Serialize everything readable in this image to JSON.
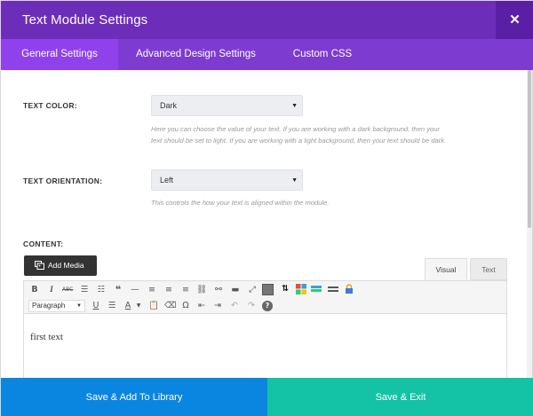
{
  "header": {
    "title": "Text Module Settings",
    "close_icon": "close-icon"
  },
  "tabs": [
    {
      "label": "General Settings",
      "active": true
    },
    {
      "label": "Advanced Design Settings",
      "active": false
    },
    {
      "label": "Custom CSS",
      "active": false
    }
  ],
  "fields": {
    "text_color": {
      "label": "TEXT COLOR:",
      "value": "Dark",
      "description_line1": "Here you can choose the value of your text. If you are working with a dark background, then your",
      "description_line2": "text should be set to light. If you are working with a light background, then your text should be dark."
    },
    "text_orientation": {
      "label": "TEXT ORIENTATION:",
      "value": "Left",
      "description": "This controls the how your text is aligned within the module."
    },
    "content": {
      "label": "CONTENT:"
    }
  },
  "editor": {
    "add_media_label": "Add Media",
    "tab_visual": "Visual",
    "tab_text": "Text",
    "format_select": "Paragraph",
    "body_text": "first text",
    "toolbar_row1": [
      "bold-icon",
      "italic-icon",
      "strikethrough-icon",
      "bullet-list-icon",
      "numbered-list-icon",
      "blockquote-icon",
      "horizontal-rule-icon",
      "align-left-icon",
      "align-center-icon",
      "align-right-icon",
      "link-icon",
      "unlink-icon",
      "read-more-icon",
      "fullscreen-icon",
      "toolbar-toggle-icon",
      "shortcode-icon",
      "columns-icon",
      "tabs-icon",
      "divider-icon",
      "lock-icon"
    ],
    "toolbar_row2": [
      "underline-icon",
      "justify-icon",
      "text-color-icon",
      "paste-text-icon",
      "clear-formatting-icon",
      "special-character-icon",
      "outdent-icon",
      "indent-icon",
      "undo-icon",
      "redo-icon",
      "help-icon"
    ]
  },
  "footer": {
    "save_library": "Save & Add To Library",
    "save_exit": "Save & Exit"
  },
  "colors": {
    "header_bg": "#6c2eb9",
    "tabs_bg": "#7e3bd0",
    "active_tab": "#8f42ec",
    "save_library_bg": "#0a86e0",
    "save_exit_bg": "#14c2a5"
  }
}
